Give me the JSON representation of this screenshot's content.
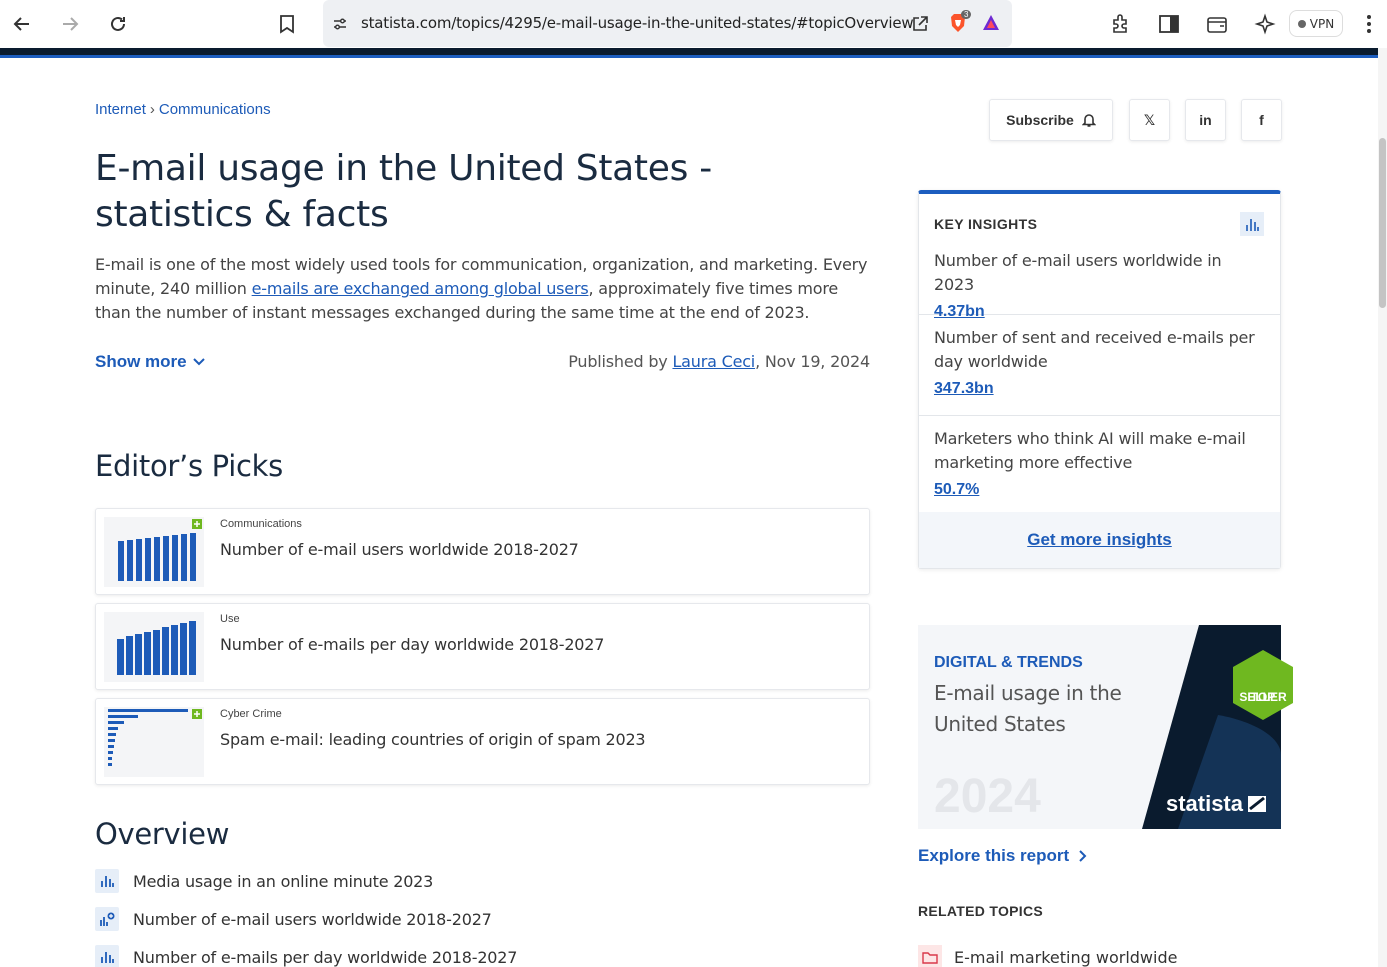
{
  "browser": {
    "url": "statista.com/topics/4295/e-mail-usage-in-the-united-states/#topicOverview",
    "vpn_label": "VPN",
    "brave_badge": "3"
  },
  "breadcrumb": [
    "Internet",
    "Communications"
  ],
  "breadcrumb_sep": "›",
  "page_title": "E-mail usage in the United States - statistics & facts",
  "intro": {
    "before": "E-mail is one of the most widely used tools for communication, organization, and marketing. Every minute, 240 million ",
    "link": "e-mails are exchanged among global users",
    "after": ", approximately five times more than the number of instant messages exchanged during the same time at the end of 2023."
  },
  "show_more": "Show more",
  "published": {
    "prefix": "Published by ",
    "author": "Laura Ceci",
    "date": ", Nov 19, 2024"
  },
  "editors_picks": {
    "heading": "Editor’s Picks",
    "items": [
      {
        "category": "Communications",
        "title": "Number of e-mail users worldwide 2018-2027"
      },
      {
        "category": "Use",
        "title": "Number of e-mails per day worldwide 2018-2027"
      },
      {
        "category": "Cyber Crime",
        "title": "Spam e-mail: leading countries of origin of spam 2023"
      }
    ]
  },
  "overview": {
    "heading": "Overview",
    "items": [
      "Media usage in an online minute 2023",
      "Number of e-mail users worldwide 2018-2027",
      "Number of e-mails per day worldwide 2018-2027"
    ]
  },
  "social": {
    "subscribe": "Subscribe",
    "x": "𝕏",
    "linkedin": "in",
    "facebook": "f"
  },
  "key_insights": {
    "heading": "KEY INSIGHTS",
    "items": [
      {
        "label": "Number of e-mail users worldwide in 2023",
        "value": "4.37bn"
      },
      {
        "label": "Number of sent and received e-mails per day worldwide",
        "value": "347.3bn"
      },
      {
        "label": "Marketers who think AI will make e-mail marketing more effective",
        "value": "50.7%"
      }
    ],
    "more": "Get more insights"
  },
  "report": {
    "kicker": "DIGITAL & TRENDS",
    "title": "E-mail usage in the United States",
    "year": "2024",
    "brand": "statista",
    "badge_line1": "TOP",
    "badge_line2": "SELLER",
    "explore": "Explore this report"
  },
  "related": {
    "heading": "RELATED TOPICS",
    "items": [
      "E-mail marketing worldwide"
    ]
  },
  "colors": {
    "accent": "#1d5bb8",
    "header_dark": "#0a1b2e",
    "badge_green": "#6fb820"
  }
}
